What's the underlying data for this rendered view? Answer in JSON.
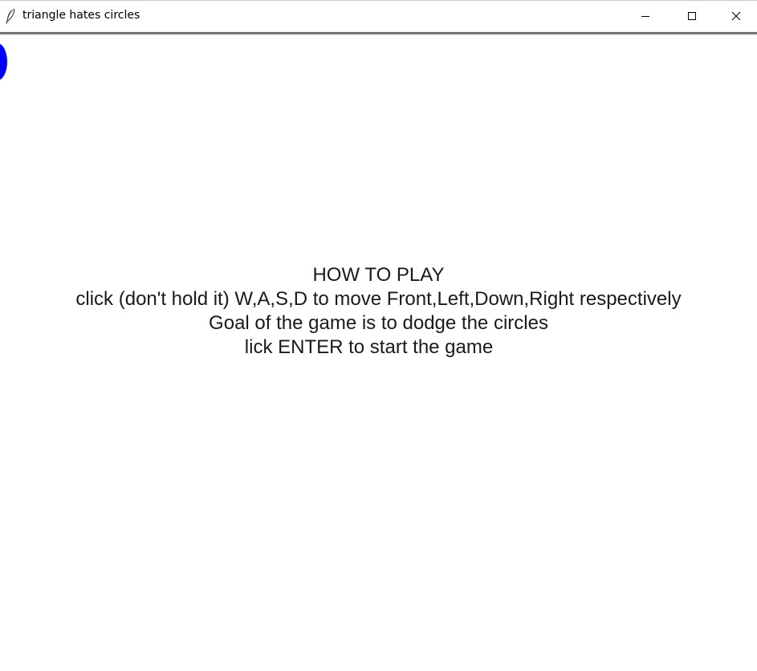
{
  "window": {
    "title": "triangle hates circles",
    "app_icon": "feather-icon",
    "controls": [
      "minimize-icon",
      "maximize-icon",
      "close-icon"
    ]
  },
  "game": {
    "circle_color": "#0000ff",
    "instructions": {
      "heading": "HOW TO PLAY",
      "controls_line": "click (don't hold it) W,A,S,D to move Front,Left,Down,Right respectively",
      "goal_line": "Goal of the game is to dodge the circles",
      "start_line": "lick ENTER to start the game"
    }
  }
}
